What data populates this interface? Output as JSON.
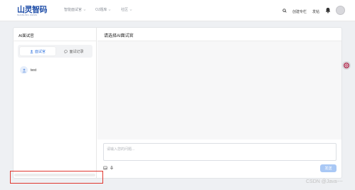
{
  "header": {
    "logo_text": "山灵智码",
    "logo_sub": "SHANLING ZHIMA",
    "nav": [
      {
        "label": "智能面试官"
      },
      {
        "label": "OJ题库"
      },
      {
        "label": "社区"
      }
    ],
    "creator_center": "创建专栏",
    "publish": "发帖"
  },
  "left_panel": {
    "title": "AI面试官",
    "tabs": [
      {
        "label": "面试官",
        "active": true
      },
      {
        "label": "面试记录",
        "active": false
      }
    ],
    "items": [
      {
        "name": "test"
      }
    ]
  },
  "right_panel": {
    "title": "请选择AI面试官",
    "input_placeholder": "请输入您的问题...",
    "send_label": "发送"
  },
  "watermark": "CSDN @Java~~",
  "colors": {
    "accent": "#3b7ae0",
    "send_disabled": "#a9c8f5",
    "highlight_box": "#e0372f",
    "logo": "#1f4ea8"
  },
  "icons": {
    "search": "search-icon",
    "bell": "bell-icon",
    "user_tab": "user-icon",
    "chat_tab": "chat-bubble-icon",
    "image_tool": "image-icon",
    "mic_tool": "microphone-icon"
  }
}
